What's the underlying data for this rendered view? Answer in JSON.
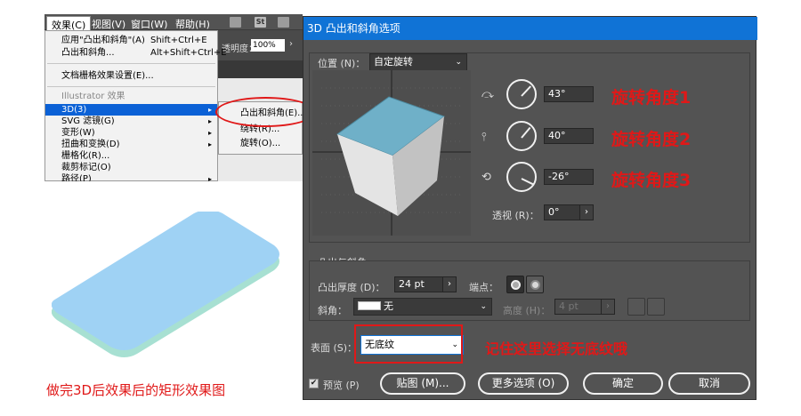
{
  "menubar": {
    "items": [
      "效果(C)",
      "视图(V)",
      "窗口(W)",
      "帮助(H)"
    ],
    "st_label": "St"
  },
  "control_bar": {
    "opacity_label": "透明度：",
    "opacity_value": "100%",
    "arrow": "›"
  },
  "effect_menu": {
    "items": [
      {
        "label": "应用\"凸出和斜角\"(A)",
        "shortcut": "Shift+Ctrl+E"
      },
      {
        "label": "凸出和斜角...",
        "shortcut": "Alt+Shift+Ctrl+E"
      },
      {
        "label": "文档栅格效果设置(E)..."
      },
      {
        "label": "Illustrator 效果"
      },
      {
        "label": "3D(3)"
      },
      {
        "label": "SVG 滤镜(G)"
      },
      {
        "label": "变形(W)"
      },
      {
        "label": "扭曲和变换(D)"
      },
      {
        "label": "栅格化(R)..."
      },
      {
        "label": "裁剪标记(O)"
      },
      {
        "label": "路径(P)"
      }
    ],
    "submenu_arrow": "▸",
    "submenu": [
      "凸出和斜角(E)...",
      "绕转(R)...",
      "旋转(O)..."
    ]
  },
  "left_caption": "做完3D后效果后的矩形效果图",
  "dialog": {
    "title": "3D 凸出和斜角选项",
    "position_label": "位置 (N)：",
    "position_value": "自定旋转",
    "rotations": [
      {
        "value": "43°",
        "annotation": "旋转角度1",
        "icon": "rotate-x-axis-icon"
      },
      {
        "value": "40°",
        "annotation": "旋转角度2",
        "icon": "rotate-y-axis-icon"
      },
      {
        "value": "-26°",
        "annotation": "旋转角度3",
        "icon": "rotate-z-axis-icon"
      }
    ],
    "perspective_label": "透视 (R)：",
    "perspective_value": "0°",
    "extrude_group_title": "凸出与斜角",
    "extrude_depth_label": "凸出厚度 (D)：",
    "extrude_depth_value": "24 pt",
    "cap_label": "端点：",
    "bevel_label": "斜角：",
    "bevel_value": "无",
    "height_label": "高度 (H)：",
    "height_value": "4 pt",
    "surface_label": "表面 (S)：",
    "surface_value": "无底纹",
    "surface_annotation": "记住这里选择无底纹哦",
    "preview_label": "预览 (P)",
    "preview_checked": "✔",
    "buttons": {
      "map": "贴图 (M)...",
      "more": "更多选项 (O)",
      "ok": "确定",
      "cancel": "取消"
    },
    "arrow": "›",
    "chevron": "⌄",
    "colors": {
      "title_bar": "#1073d6",
      "cube_top": "#6fb0c8",
      "annotation": "#e01818"
    }
  }
}
